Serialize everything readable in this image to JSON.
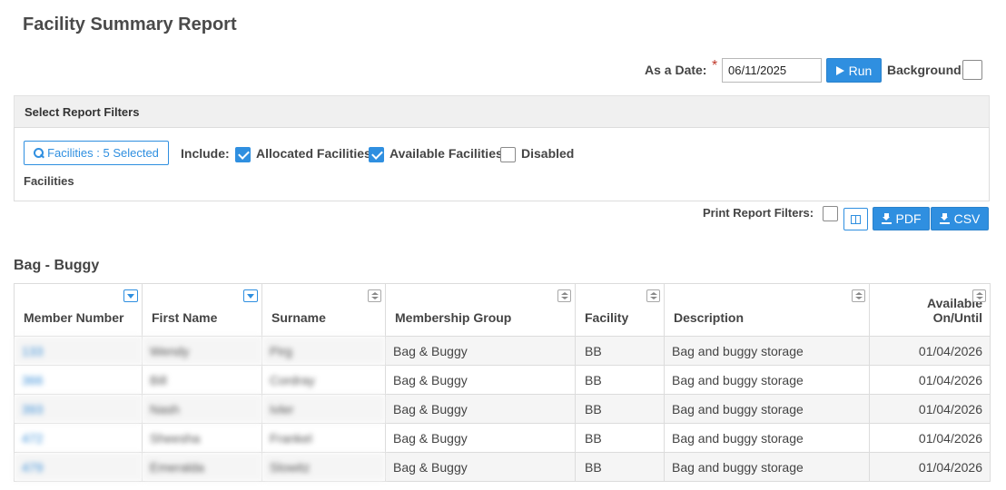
{
  "page": {
    "title": "Facility Summary Report"
  },
  "run_bar": {
    "date_label": "As a Date:",
    "required_mark": "*",
    "date_value": "06/11/2025",
    "run_label": "Run",
    "background_label": "Background:",
    "background_checked": false
  },
  "filters": {
    "header": "Select Report Filters",
    "facilities_button": "Facilities : 5 Selected",
    "include_label": "Include:",
    "options": [
      {
        "label": "Allocated Facilities",
        "checked": true
      },
      {
        "label": "Available Facilities",
        "checked": true
      },
      {
        "label": "Disabled",
        "checked": false
      }
    ],
    "sub_label": "Facilities"
  },
  "export_bar": {
    "print_filters_label": "Print Report Filters:",
    "print_filters_checked": false,
    "pdf_label": "PDF",
    "csv_label": "CSV"
  },
  "section": {
    "title": "Bag - Buggy"
  },
  "table": {
    "columns": [
      {
        "label": "Member Number",
        "indicator": "filter"
      },
      {
        "label": "First Name",
        "indicator": "filter"
      },
      {
        "label": "Surname",
        "indicator": "sort"
      },
      {
        "label": "Membership Group",
        "indicator": "sort"
      },
      {
        "label": "Facility",
        "indicator": "sort"
      },
      {
        "label": "Description",
        "indicator": "sort"
      },
      {
        "label": "Available On/Until",
        "indicator": "sort"
      }
    ],
    "rows": [
      {
        "member": "133",
        "first": "Wendy",
        "surname": "Pirg",
        "group": "Bag & Buggy",
        "facility": "BB",
        "description": "Bag and buggy storage",
        "available": "01/04/2026"
      },
      {
        "member": "366",
        "first": "Bill",
        "surname": "Cordray",
        "group": "Bag & Buggy",
        "facility": "BB",
        "description": "Bag and buggy storage",
        "available": "01/04/2026"
      },
      {
        "member": "393",
        "first": "Nash",
        "surname": "Ivler",
        "group": "Bag & Buggy",
        "facility": "BB",
        "description": "Bag and buggy storage",
        "available": "01/04/2026"
      },
      {
        "member": "472",
        "first": "Sheesha",
        "surname": "Frankel",
        "group": "Bag & Buggy",
        "facility": "BB",
        "description": "Bag and buggy storage",
        "available": "01/04/2026"
      },
      {
        "member": "479",
        "first": "Emeralda",
        "surname": "Slowitz",
        "group": "Bag & Buggy",
        "facility": "BB",
        "description": "Bag and buggy storage",
        "available": "01/04/2026"
      }
    ]
  }
}
